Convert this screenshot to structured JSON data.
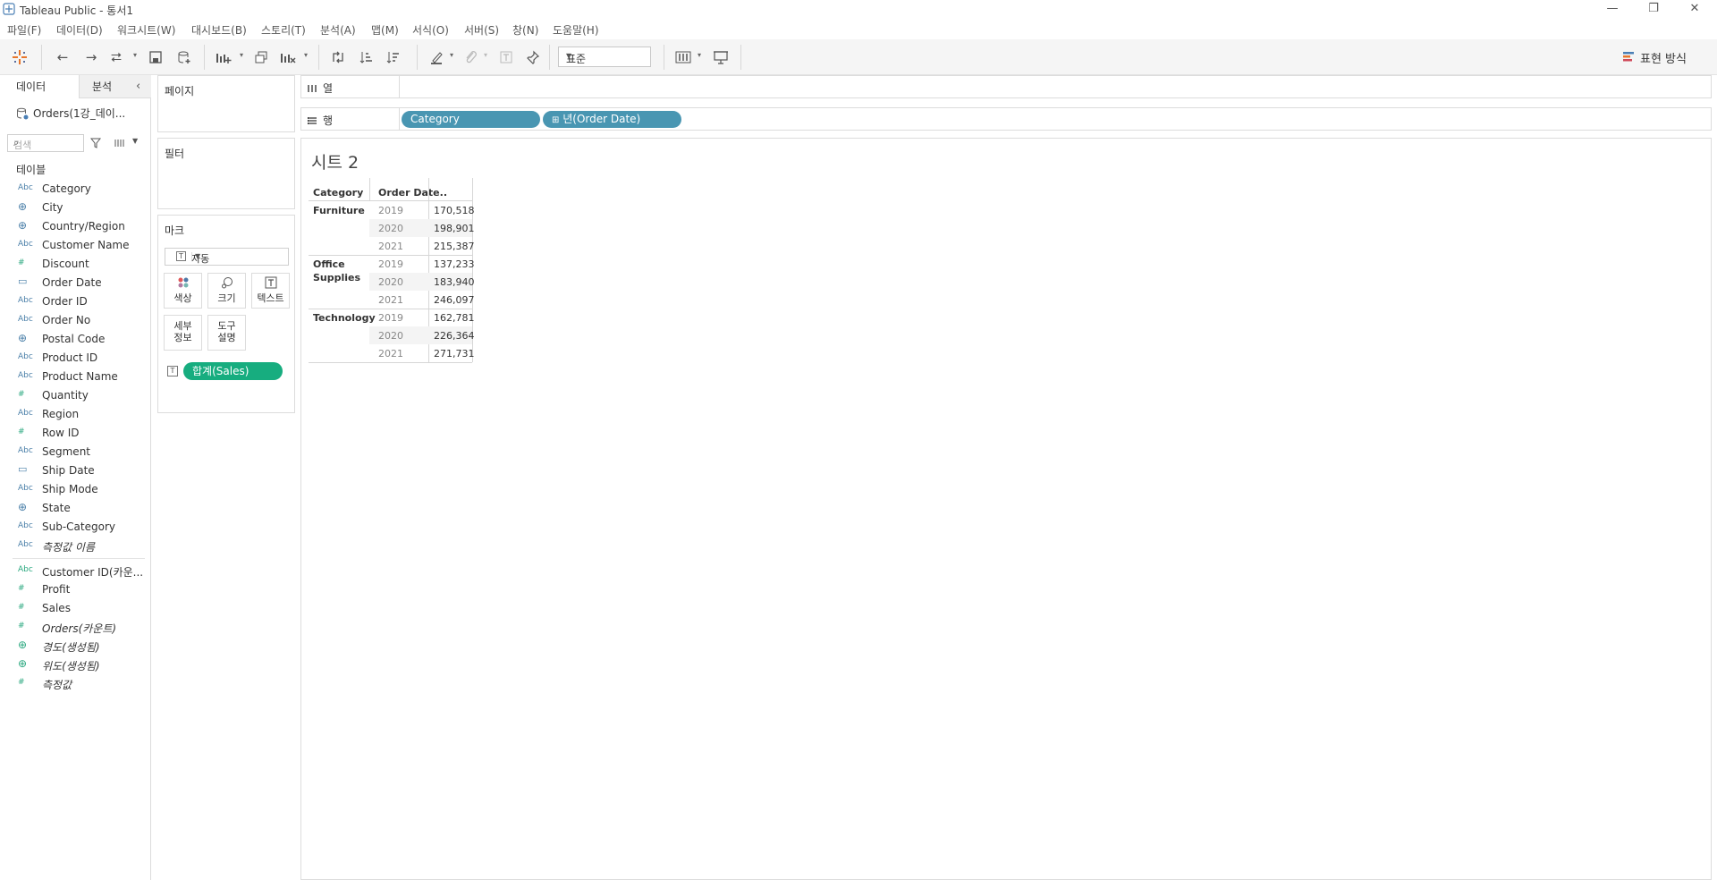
{
  "app": {
    "title": "Tableau Public - 통서1",
    "window_controls": [
      "—",
      "❐",
      "✕"
    ]
  },
  "menu": [
    "파일(F)",
    "데이터(D)",
    "워크시트(W)",
    "대시보드(B)",
    "스토리(T)",
    "분석(A)",
    "맵(M)",
    "서식(O)",
    "서버(S)",
    "창(N)",
    "도움말(H)"
  ],
  "toolbar": {
    "fit_select": "표준",
    "show_me": "표현 방식",
    "icons": [
      "tableau-logo-icon",
      "undo-icon",
      "redo-icon",
      "replay-icon",
      "save-icon",
      "new-datasource-icon",
      "new-worksheet-icon",
      "duplicate-icon",
      "clear-icon",
      "swap-icon",
      "sort-asc-icon",
      "sort-desc-icon",
      "highlight-icon",
      "group-icon",
      "label-icon",
      "pin-icon",
      "show-cards-icon",
      "presentation-icon"
    ]
  },
  "data_pane": {
    "tab_data": "데이터",
    "tab_analysis": "분석",
    "datasource": "Orders(1강_데이...",
    "search_placeholder": "검색",
    "tables_label": "테이블",
    "dimensions": [
      {
        "type": "Abc",
        "name": "Category"
      },
      {
        "type": "geo",
        "name": "City"
      },
      {
        "type": "geo",
        "name": "Country/Region"
      },
      {
        "type": "Abc",
        "name": "Customer Name"
      },
      {
        "type": "#",
        "name": "Discount"
      },
      {
        "type": "date",
        "name": "Order Date"
      },
      {
        "type": "Abc",
        "name": "Order ID"
      },
      {
        "type": "Abc",
        "name": "Order No"
      },
      {
        "type": "geo",
        "name": "Postal Code"
      },
      {
        "type": "Abc",
        "name": "Product ID"
      },
      {
        "type": "Abc",
        "name": "Product Name"
      },
      {
        "type": "#",
        "name": "Quantity"
      },
      {
        "type": "Abc",
        "name": "Region"
      },
      {
        "type": "#",
        "name": "Row ID"
      },
      {
        "type": "Abc",
        "name": "Segment"
      },
      {
        "type": "date",
        "name": "Ship Date"
      },
      {
        "type": "Abc",
        "name": "Ship Mode"
      },
      {
        "type": "geo",
        "name": "State"
      },
      {
        "type": "Abc",
        "name": "Sub-Category"
      },
      {
        "type": "Abc",
        "name": "측정값 이름",
        "italic": true
      }
    ],
    "measures": [
      {
        "type": "Abc",
        "name": "Customer ID(카운..."
      },
      {
        "type": "#",
        "name": "Profit"
      },
      {
        "type": "#",
        "name": "Sales"
      },
      {
        "type": "#",
        "name": "Orders(카운트)",
        "italic": true
      },
      {
        "type": "geo",
        "name": "경도(생성됨)",
        "italic": true
      },
      {
        "type": "geo",
        "name": "위도(생성됨)",
        "italic": true
      },
      {
        "type": "#",
        "name": "측정값",
        "italic": true
      }
    ]
  },
  "cards": {
    "pages": "페이지",
    "filters": "필터",
    "marks": "마크",
    "mark_type": "자동",
    "buttons": [
      "색상",
      "크기",
      "텍스트",
      "세부\n정보",
      "도구\n설명"
    ],
    "mark_pill": "합계(Sales)"
  },
  "shelves": {
    "columns_label": "열",
    "rows_label": "행",
    "column_pills": [
      "Category",
      "년(Order Date)"
    ]
  },
  "sheet": {
    "title": "시트 2",
    "headers": [
      "Category",
      "Order Date.."
    ],
    "rows": [
      {
        "category": "Furniture",
        "year": "2019",
        "value": "170,518"
      },
      {
        "category": "",
        "year": "2020",
        "value": "198,901"
      },
      {
        "category": "",
        "year": "2021",
        "value": "215,387"
      },
      {
        "category": "Office\nSupplies",
        "year": "2019",
        "value": "137,233"
      },
      {
        "category": "",
        "year": "2020",
        "value": "183,940"
      },
      {
        "category": "",
        "year": "2021",
        "value": "246,097"
      },
      {
        "category": "Technology",
        "year": "2019",
        "value": "162,781"
      },
      {
        "category": "",
        "year": "2020",
        "value": "226,364"
      },
      {
        "category": "",
        "year": "2021",
        "value": "271,731"
      }
    ]
  }
}
